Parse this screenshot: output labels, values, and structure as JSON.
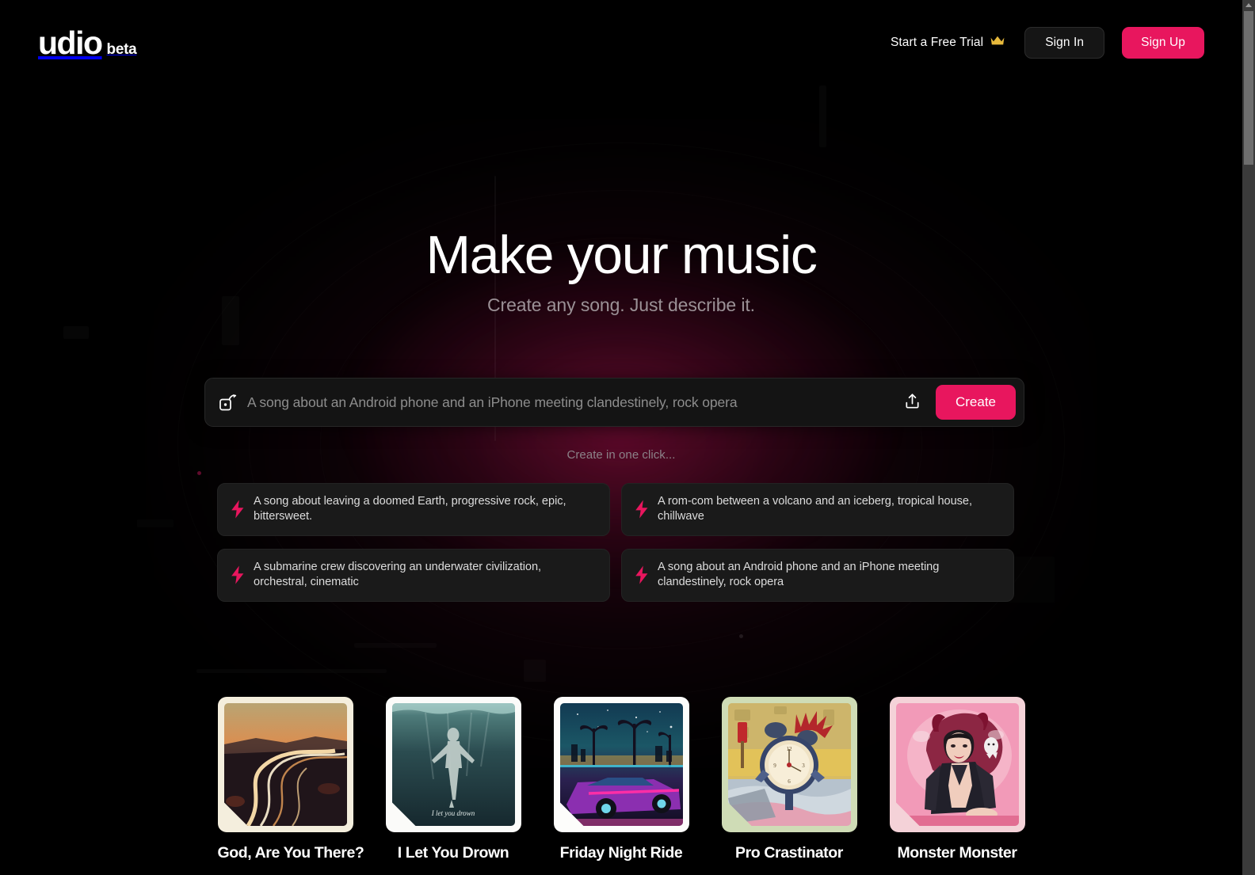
{
  "header": {
    "logo_mark": "udio",
    "logo_beta": "beta",
    "trial_label": "Start a Free Trial",
    "trial_icon": "crown-icon",
    "signin_label": "Sign In",
    "signup_label": "Sign Up"
  },
  "hero": {
    "title": "Make your music",
    "subtitle": "Create any song. Just describe it."
  },
  "prompt": {
    "dice_icon": "dice-randomize-icon",
    "value": "",
    "placeholder": "A song about an Android phone and an iPhone meeting clandestinely, rock opera",
    "upload_icon": "upload-icon",
    "create_label": "Create"
  },
  "oneclick": {
    "label": "Create in one click...",
    "suggestions": [
      {
        "icon": "lightning-bolt-icon",
        "text": "A song about leaving a doomed Earth, progressive rock, epic, bittersweet."
      },
      {
        "icon": "lightning-bolt-icon",
        "text": "A rom-com between a volcano and an iceberg, tropical house, chillwave"
      },
      {
        "icon": "lightning-bolt-icon",
        "text": "A submarine crew discovering an underwater civilization, orchestral, cinematic"
      },
      {
        "icon": "lightning-bolt-icon",
        "text": "A song about an Android phone and an iPhone meeting clandestinely, rock opera"
      }
    ]
  },
  "songs": [
    {
      "title": "God, Are You There?",
      "frame_color": "#f4eedd",
      "art": "sunset-highway-light-trails"
    },
    {
      "title": "I Let You Drown",
      "frame_color": "#fbfbf9",
      "art": "underwater-figure-sinking"
    },
    {
      "title": "Friday Night Ride",
      "frame_color": "#fdfdfb",
      "art": "synthwave-palm-cadillac"
    },
    {
      "title": "Pro Crastinator",
      "frame_color": "#cfdcb6",
      "art": "alarm-clock-monster-bedroom"
    },
    {
      "title": "Monster Monster",
      "frame_color": "#f4d2d8",
      "art": "pink-devil-woman-leather"
    }
  ],
  "colors": {
    "accent_pink": "#e8165e",
    "background": "#000000",
    "panel": "#1a1a1a",
    "crown_gold": "#e7b93c"
  },
  "scrollbar": {
    "position_label": "top"
  }
}
